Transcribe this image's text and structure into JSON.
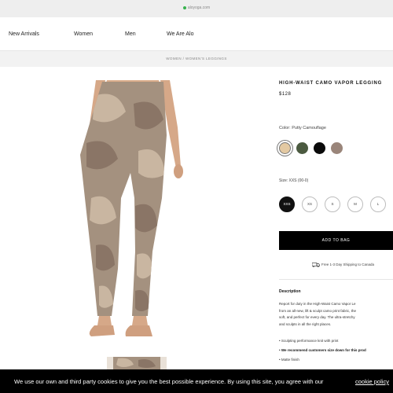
{
  "browser": {
    "url": "aloyoga.com"
  },
  "nav": {
    "items": [
      "New Arrivals",
      "Women",
      "Men",
      "We Are Alo"
    ]
  },
  "breadcrumb": "WOMEN / WOMEN'S LEGGINGS",
  "product": {
    "title": "HIGH-WAIST CAMO VAPOR LEGGING",
    "price": "$128",
    "color_label": "Color: Putty Camouflage",
    "swatches": [
      {
        "name": "Putty Camouflage",
        "color": "#e3c9a2",
        "selected": true
      },
      {
        "name": "Olive",
        "color": "#4b5a40",
        "selected": false
      },
      {
        "name": "Black",
        "color": "#0a0a0a",
        "selected": false
      },
      {
        "name": "Taupe",
        "color": "#9a857a",
        "selected": false
      }
    ],
    "size_label": "Size: XXS (00-0)",
    "sizes": [
      "XXS",
      "XS",
      "S",
      "M",
      "L"
    ],
    "selected_size": "XXS",
    "add_to_bag": "ADD TO BAG",
    "shipping": "Free 1-3 Day Shipping to Canada",
    "description_heading": "Description",
    "description_lines": [
      "Report for duty in the High-Waist Camo Vapor Le",
      "from an all-new, lift & sculpt camo print fabric, the",
      "soft, and perfect for every day. The ultra-stretchy",
      "and sculpts in all the right places."
    ],
    "bullets": [
      {
        "text": "• Sculpting performance knit with print",
        "bold": false
      },
      {
        "text": "• We recommend customers size down for this prod",
        "bold": true
      },
      {
        "text": "• Matte finish",
        "bold": false
      }
    ]
  },
  "cookie": {
    "text": "We use our own and third party cookies to give you the best possible experience. By using this site, you agree with our",
    "link": "cookie policy"
  },
  "colors": {
    "camo_base": "#a4917f",
    "camo_dark": "#8a7566",
    "camo_light": "#c9b6a1",
    "skin": "#dcae8c"
  }
}
